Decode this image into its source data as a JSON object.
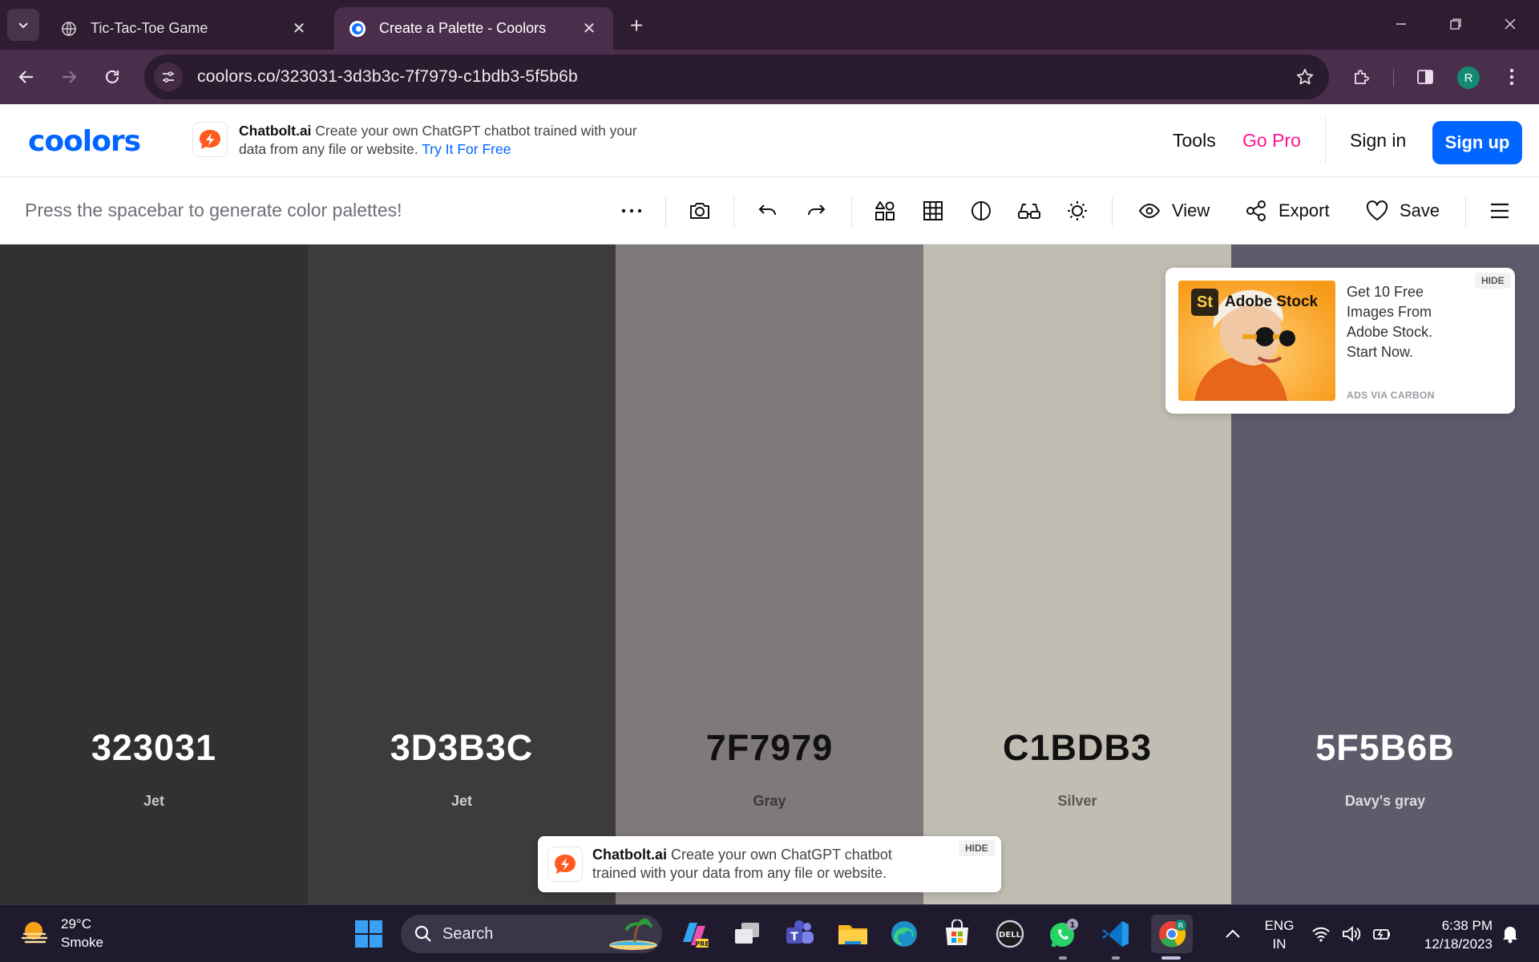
{
  "browser": {
    "tabs": [
      {
        "title": "Tic-Tac-Toe Game",
        "active": false
      },
      {
        "title": "Create a Palette - Coolors",
        "active": true
      }
    ],
    "url": "coolors.co/323031-3d3b3c-7f7979-c1bdb3-5f5b6b",
    "profile_initial": "R"
  },
  "header": {
    "logo": "coolors",
    "ad": {
      "brand": "Chatbolt.ai",
      "text": "Create your own ChatGPT chatbot trained with your data from any file or website.",
      "cta": "Try It For Free"
    },
    "nav": {
      "tools": "Tools",
      "go_pro": "Go Pro",
      "sign_in": "Sign in",
      "sign_up": "Sign up"
    }
  },
  "generator_bar": {
    "hint": "Press the spacebar to generate color palettes!",
    "view_label": "View",
    "export_label": "Export",
    "save_label": "Save"
  },
  "palette": [
    {
      "hex": "323031",
      "name": "Jet",
      "color": "#323031",
      "text_color": "#ffffff",
      "name_color": "#c8c6c7"
    },
    {
      "hex": "3D3B3C",
      "name": "Jet",
      "color": "#3d3b3c",
      "text_color": "#ffffff",
      "name_color": "#cfcdce"
    },
    {
      "hex": "7F7979",
      "name": "Gray",
      "color": "#7f7979",
      "text_color": "#111111",
      "name_color": "#3c3838"
    },
    {
      "hex": "C1BDB3",
      "name": "Silver",
      "color": "#c1bdb3",
      "text_color": "#111111",
      "name_color": "#5a5750"
    },
    {
      "hex": "5F5B6B",
      "name": "Davy's gray",
      "color": "#5f5b6b",
      "text_color": "#ffffff",
      "name_color": "#dcdae2"
    }
  ],
  "carbon_ad": {
    "image_badge": "St",
    "image_title": "Adobe Stock",
    "copy": "Get 10 Free Images From Adobe Stock. Start Now.",
    "via": "ADS VIA CARBON",
    "hide": "HIDE"
  },
  "bottom_ad": {
    "brand": "Chatbolt.ai",
    "text": "Create your own ChatGPT chatbot trained with your data from any file or website.",
    "hide": "HIDE"
  },
  "taskbar": {
    "weather": {
      "temp": "29°C",
      "condition": "Smoke"
    },
    "search_placeholder": "Search",
    "whatsapp_badge": "1",
    "language": {
      "line1": "ENG",
      "line2": "IN"
    },
    "clock": {
      "time": "6:38 PM",
      "date": "12/18/2023"
    }
  }
}
